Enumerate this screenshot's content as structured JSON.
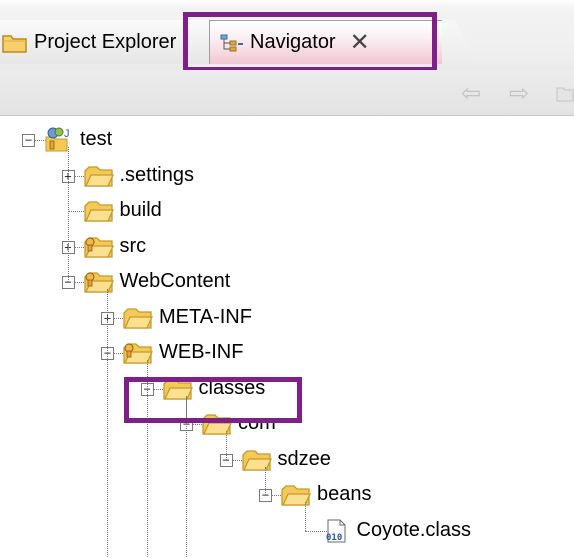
{
  "tabs": {
    "project_explorer": "Project Explorer",
    "navigator": "Navigator"
  },
  "toolbar": {
    "back_icon": "back-arrow-icon",
    "forward_icon": "forward-arrow-icon",
    "up_icon": "up-folder-icon"
  },
  "tree": [
    {
      "label": "test",
      "icon": "project-icon",
      "level": 0,
      "expander": "minus"
    },
    {
      "label": ".settings",
      "icon": "folder-icon",
      "level": 1,
      "expander": "plus"
    },
    {
      "label": "build",
      "icon": "folder-icon",
      "level": 1,
      "expander": "none"
    },
    {
      "label": "src",
      "icon": "folder-decorated-icon",
      "level": 1,
      "expander": "plus"
    },
    {
      "label": "WebContent",
      "icon": "folder-decorated-icon",
      "level": 1,
      "expander": "minus"
    },
    {
      "label": "META-INF",
      "icon": "folder-icon",
      "level": 2,
      "expander": "plus"
    },
    {
      "label": "WEB-INF",
      "icon": "folder-decorated-icon",
      "level": 2,
      "expander": "minus"
    },
    {
      "label": "classes",
      "icon": "folder-icon",
      "level": 3,
      "expander": "minus"
    },
    {
      "label": "com",
      "icon": "folder-icon",
      "level": 4,
      "expander": "minus"
    },
    {
      "label": "sdzee",
      "icon": "folder-icon",
      "level": 5,
      "expander": "minus"
    },
    {
      "label": "beans",
      "icon": "folder-icon",
      "level": 6,
      "expander": "minus"
    },
    {
      "label": "Coyote.class",
      "icon": "class-file-icon",
      "level": 7,
      "expander": "none"
    }
  ],
  "colors": {
    "highlight": "#7e1f8a",
    "folder": "#f4c956",
    "folder_dark": "#c89a2a"
  }
}
